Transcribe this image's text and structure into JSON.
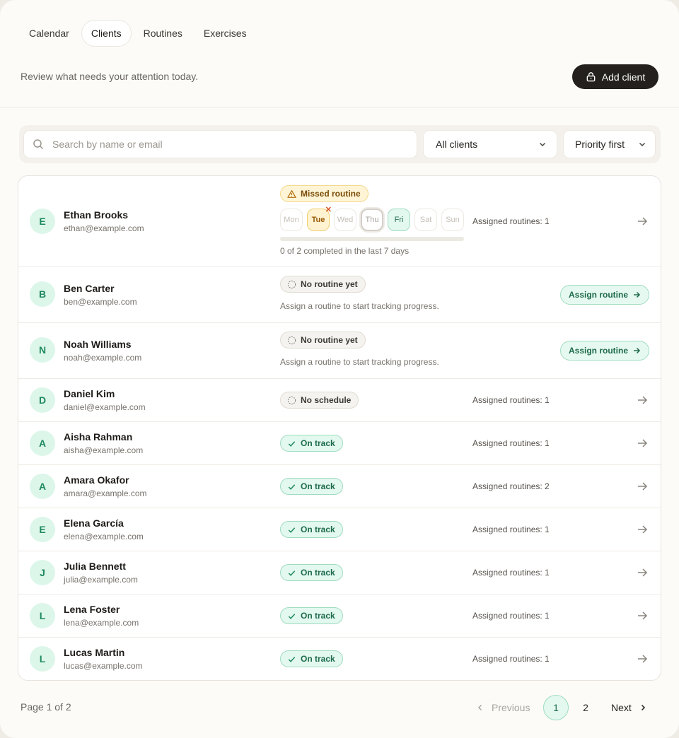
{
  "nav": {
    "tabs": [
      {
        "label": "Calendar",
        "active": false
      },
      {
        "label": "Clients",
        "active": true
      },
      {
        "label": "Routines",
        "active": false
      },
      {
        "label": "Exercises",
        "active": false
      }
    ]
  },
  "header": {
    "subtitle": "Review what needs your attention today.",
    "add_client_label": "Add client"
  },
  "filters": {
    "search_placeholder": "Search by name or email",
    "client_filter": "All clients",
    "sort": "Priority first"
  },
  "clients": [
    {
      "initial": "E",
      "name": "Ethan Brooks",
      "email": "ethan@example.com",
      "status": "Missed routine",
      "assigned": "Assigned routines: 1",
      "days": [
        "Mon",
        "Tue",
        "Wed",
        "Thu",
        "Fri",
        "Sat",
        "Sun"
      ],
      "progress_text": "0 of 2 completed in the last 7 days",
      "progress_fraction": 0
    },
    {
      "initial": "B",
      "name": "Ben Carter",
      "email": "ben@example.com",
      "status": "No routine yet",
      "hint": "Assign a routine to start tracking progress.",
      "action": "Assign routine"
    },
    {
      "initial": "N",
      "name": "Noah Williams",
      "email": "noah@example.com",
      "status": "No routine yet",
      "hint": "Assign a routine to start tracking progress.",
      "action": "Assign routine"
    },
    {
      "initial": "D",
      "name": "Daniel Kim",
      "email": "daniel@example.com",
      "status": "No schedule",
      "assigned": "Assigned routines: 1"
    },
    {
      "initial": "A",
      "name": "Aisha Rahman",
      "email": "aisha@example.com",
      "status": "On track",
      "assigned": "Assigned routines: 1"
    },
    {
      "initial": "A",
      "name": "Amara Okafor",
      "email": "amara@example.com",
      "status": "On track",
      "assigned": "Assigned routines: 2"
    },
    {
      "initial": "E",
      "name": "Elena García",
      "email": "elena@example.com",
      "status": "On track",
      "assigned": "Assigned routines: 1"
    },
    {
      "initial": "J",
      "name": "Julia Bennett",
      "email": "julia@example.com",
      "status": "On track",
      "assigned": "Assigned routines: 1"
    },
    {
      "initial": "L",
      "name": "Lena Foster",
      "email": "lena@example.com",
      "status": "On track",
      "assigned": "Assigned routines: 1"
    },
    {
      "initial": "L",
      "name": "Lucas Martin",
      "email": "lucas@example.com",
      "status": "On track",
      "assigned": "Assigned routines: 1"
    }
  ],
  "pagination": {
    "info": "Page 1 of 2",
    "previous": "Previous",
    "pages": [
      "1",
      "2"
    ],
    "current": "1",
    "next": "Next"
  },
  "colors": {
    "accent": "#23201d",
    "success": "#1d6b4b",
    "warning": "#7a4b07"
  }
}
